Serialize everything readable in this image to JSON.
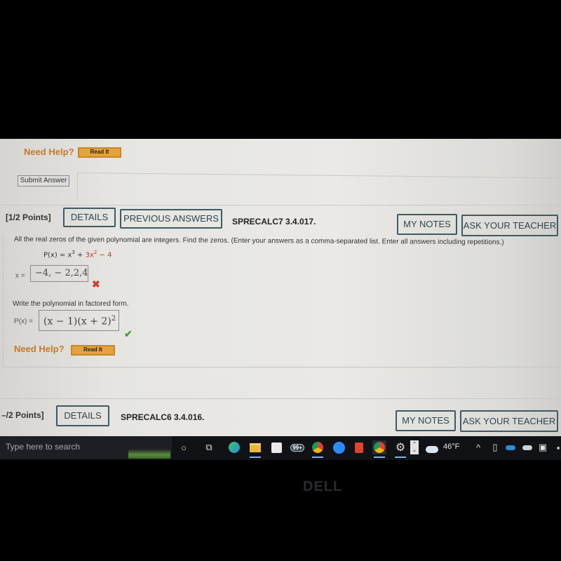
{
  "previous_question": {
    "need_help_label": "Need Help?",
    "read_it_label": "Read It",
    "submit_label": "Submit Answer"
  },
  "question": {
    "points": "[1/2 Points]",
    "details_label": "DETAILS",
    "previous_answers_label": "PREVIOUS ANSWERS",
    "id": "SPRECALC7 3.4.017.",
    "my_notes_label": "MY NOTES",
    "ask_teacher_label": "ASK YOUR TEACHER",
    "prompt": "All the real zeros of the given polynomial are integers. Find the zeros. (Enter your answers as a comma-separated list. Enter all answers including repetitions.)",
    "polynomial": {
      "prefix": "P(x) = x",
      "exp1": "3",
      "plus": " + ",
      "term2": "3x",
      "exp2": "2",
      "term3": " − 4"
    },
    "part1": {
      "label": "x =",
      "answer": "−4, − 2,2,4",
      "status": "incorrect"
    },
    "part2": {
      "instruction": "Write the polynomial in factored form.",
      "label": "P(x) =",
      "answer_base": "(x − 1)(x + 2)",
      "answer_exp": "2",
      "status": "correct"
    },
    "need_help_label": "Need Help?",
    "read_it_label": "Read It"
  },
  "next_question": {
    "points": "–/2 Points]",
    "details_label": "DETAILS",
    "id": "SPRECALC6 3.4.016.",
    "my_notes_label": "MY NOTES",
    "ask_teacher_label": "ASK YOUR TEACHER"
  },
  "taskbar": {
    "search_placeholder": "Type here to search",
    "mail_badge": "99+",
    "weather_temp": "46°F",
    "icons": [
      "cortana-icon",
      "task-view-icon",
      "edge-icon",
      "file-explorer-icon",
      "store-icon",
      "mail-icon",
      "chrome-icon",
      "zoom-icon",
      "office-icon",
      "chrome-profile-icon",
      "settings-icon"
    ]
  },
  "bezel": {
    "brand": "DELL"
  },
  "colors": {
    "need_help": "#c47a2c",
    "read_it_bg": "#e6a33a",
    "button_border": "#3d5a66",
    "incorrect": "#d23b3b",
    "correct": "#4a9a3a"
  }
}
